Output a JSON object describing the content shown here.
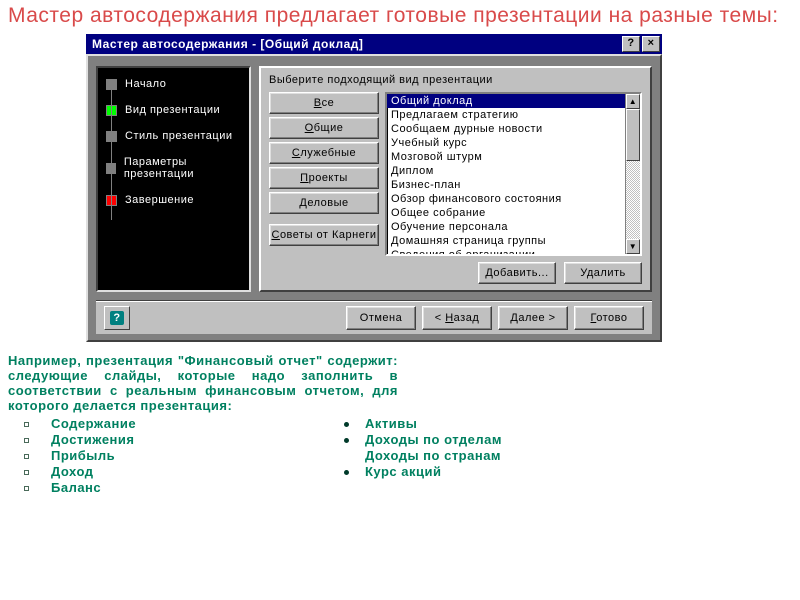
{
  "heading": "Мастер автосодержания предлагает готовые презентации на разные темы:",
  "dialog": {
    "title": "Мастер автосодержания - [Общий доклад]",
    "steps": [
      "Начало",
      "Вид презентации",
      "Стиль презентации",
      "Параметры презентации",
      "Завершение"
    ],
    "prompt": "Выберите подходящий вид презентации",
    "categories": [
      "Все",
      "Общие",
      "Служебные",
      "Проекты",
      "Деловые",
      "Советы от Карнеги"
    ],
    "list": [
      "Общий доклад",
      "Предлагаем стратегию",
      "Сообщаем дурные новости",
      "Учебный курс",
      "Мозговой штурм",
      "Диплом",
      "Бизнес-план",
      "Обзор финансового состояния",
      "Общее собрание",
      "Обучение персонала",
      "Домашняя страница группы",
      "Сведения об организации"
    ],
    "selected": "Общий доклад",
    "buttons": {
      "add": "Добавить...",
      "remove": "Удалить",
      "cancel": "Отмена",
      "back": "< Назад",
      "next": "Далее >",
      "finish": "Готово"
    }
  },
  "paragraph": "Например, презентация \"Финансовый отчет\" содержит: следующие слайды, которые надо заполнить в соответствии с реальным финансовым отчетом, для которого делается презентация:",
  "bullets1": [
    "Содержание",
    "Достижения",
    "Прибыль",
    "Доход",
    "Баланс"
  ],
  "bullets2": [
    "Активы",
    "Доходы по отделам",
    "Доходы по странам",
    "Курс акций"
  ]
}
